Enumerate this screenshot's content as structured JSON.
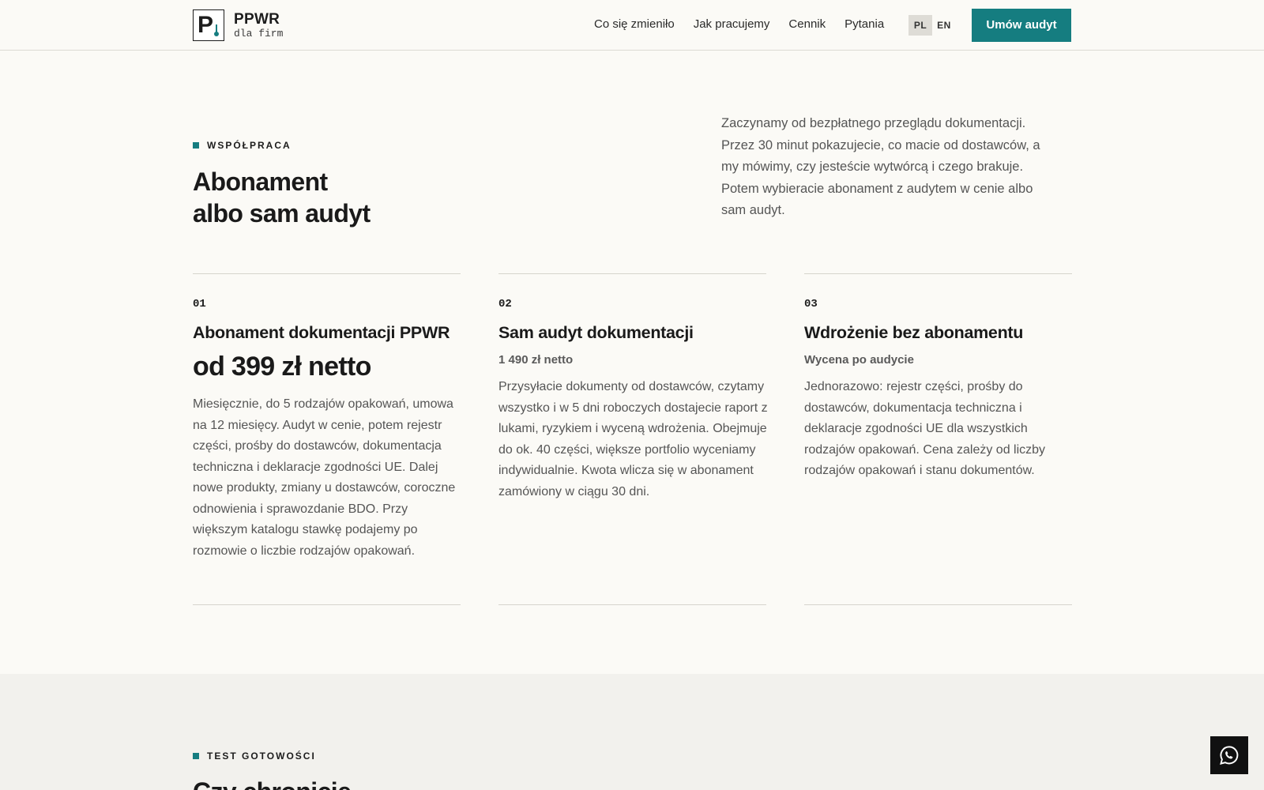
{
  "header": {
    "logo_letter": "P",
    "logo_name": "PPWR",
    "logo_sub": "dla firm",
    "nav": [
      "Co się zmieniło",
      "Jak pracujemy",
      "Cennik",
      "Pytania"
    ],
    "lang": [
      "PL",
      "EN"
    ],
    "lang_active": "PL",
    "cta": "Umów audyt"
  },
  "intro": {
    "kicker": "WSPÓŁPRACA",
    "title_line1": "Abonament",
    "title_line2": "albo sam audyt",
    "text": "Zaczynamy od bezpłatnego przeglądu dokumentacji. Przez 30 minut pokazujecie, co macie od dostawców, a my mówimy, czy jesteście wytwórcą i czego brakuje. Potem wybieracie abonament z audytem w cenie albo sam audyt."
  },
  "cards": [
    {
      "num": "01",
      "title": "Abonament dokumentacji PPWR",
      "price": "od 399 zł netto",
      "desc": "Miesięcznie, do 5 rodzajów opakowań, umowa na 12 miesięcy. Audyt w cenie, potem rejestr części, prośby do dostawców, dokumentacja techniczna i deklaracje zgodności UE. Dalej nowe produkty, zmiany u dostawców, coroczne odnowienia i sprawozdanie BDO. Przy większym katalogu stawkę podajemy po rozmowie o liczbie rodzajów opakowań."
    },
    {
      "num": "02",
      "title": "Sam audyt dokumentacji",
      "price": "1 490 zł netto",
      "desc": "Przysyłacie dokumenty od dostawców, czytamy wszystko i w 5 dni roboczych dostajecie raport z lukami, ryzykiem i wyceną wdrożenia. Obejmuje do ok. 40 części, większe portfolio wyceniamy indywidualnie. Kwota wlicza się w abonament zamówiony w ciągu 30 dni."
    },
    {
      "num": "03",
      "title": "Wdrożenie bez abonamentu",
      "price": "Wycena po audycie",
      "desc": "Jednorazowo: rejestr części, prośby do dostawców, dokumentacja techniczna i deklaracje zgodności UE dla wszystkich rodzajów opakowań. Cena zależy od liczby rodzajów opakowań i stanu dokumentów."
    }
  ],
  "section2": {
    "kicker": "TEST GOTOWOŚCI",
    "title": "Czy chronicie"
  },
  "colors": {
    "accent": "#157d80",
    "background": "#fbfaf6",
    "section_alt": "#f2f1ed"
  },
  "icons": {
    "chat": "whatsapp-icon"
  }
}
